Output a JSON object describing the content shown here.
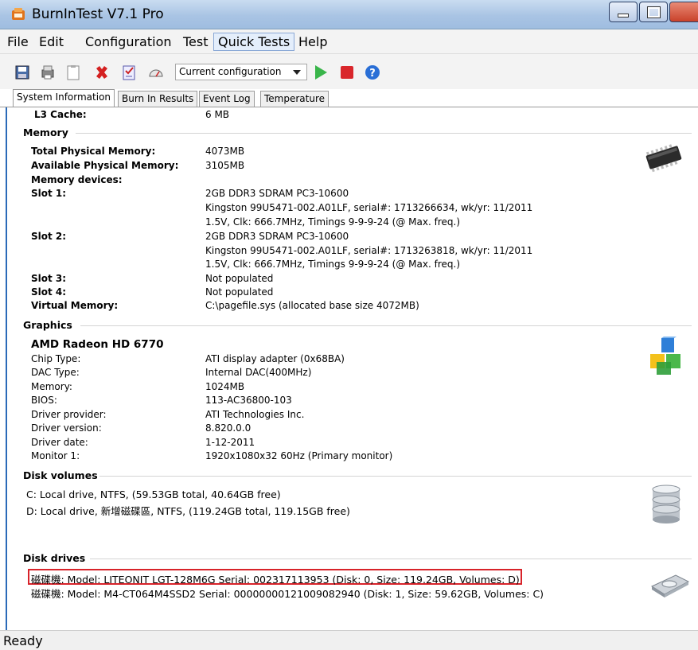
{
  "window": {
    "title": "BurnInTest V7.1 Pro"
  },
  "menu": [
    "File",
    "Edit",
    "Configuration",
    "Test",
    "Quick Tests",
    "Help"
  ],
  "toolbar": {
    "config_value": "Current configuration"
  },
  "tabs": [
    "System Information",
    "Burn In Results",
    "Event Log",
    "Temperature"
  ],
  "cpu_partial": {
    "label": "L3 Cache:",
    "value": "6 MB"
  },
  "memory": {
    "header": "Memory",
    "rows": [
      {
        "label": "Total Physical Memory:",
        "value": "4073MB"
      },
      {
        "label": "Available Physical Memory:",
        "value": "3105MB"
      },
      {
        "label": "Memory devices:",
        "value": ""
      },
      {
        "label": "Slot 1:",
        "value": "2GB DDR3 SDRAM PC3-10600"
      },
      {
        "label": "",
        "value": "Kingston 99U5471-002.A01LF, serial#: 1713266634, wk/yr: 11/2011"
      },
      {
        "label": "",
        "value": "1.5V, Clk: 666.7MHz, Timings 9-9-9-24 (@ Max. freq.)"
      },
      {
        "label": "Slot 2:",
        "value": "2GB DDR3 SDRAM PC3-10600"
      },
      {
        "label": "",
        "value": "Kingston 99U5471-002.A01LF, serial#: 1713263818, wk/yr: 11/2011"
      },
      {
        "label": "",
        "value": "1.5V, Clk: 666.7MHz, Timings 9-9-9-24 (@ Max. freq.)"
      },
      {
        "label": "Slot 3:",
        "value": "Not populated"
      },
      {
        "label": "Slot 4:",
        "value": "Not populated"
      },
      {
        "label": "Virtual Memory:",
        "value": "C:\\pagefile.sys (allocated base size 4072MB)"
      }
    ]
  },
  "graphics": {
    "header": "Graphics",
    "card_name": "AMD Radeon HD 6770",
    "rows": [
      {
        "label": "Chip Type:",
        "value": "ATI display adapter (0x68BA)"
      },
      {
        "label": "DAC Type:",
        "value": "Internal DAC(400MHz)"
      },
      {
        "label": "Memory:",
        "value": "1024MB"
      },
      {
        "label": "BIOS:",
        "value": "113-AC36800-103"
      },
      {
        "label": "Driver provider:",
        "value": "ATI Technologies Inc."
      },
      {
        "label": "Driver version:",
        "value": "8.820.0.0"
      },
      {
        "label": "Driver date:",
        "value": "1-12-2011"
      },
      {
        "label": "Monitor 1:",
        "value": "1920x1080x32 60Hz (Primary monitor)"
      }
    ]
  },
  "disk_volumes": {
    "header": "Disk volumes",
    "items": [
      "C: Local drive, NTFS, (59.53GB total, 40.64GB free)",
      "D: Local drive, 新增磁碟區, NTFS, (119.24GB total, 119.15GB free)"
    ]
  },
  "disk_drives": {
    "header": "Disk drives",
    "items": [
      "磁碟機: Model: LITEONIT LGT-128M6G Serial: 002317113953 (Disk: 0, Size: 119.24GB, Volumes: D)",
      "磁碟機: Model: M4-CT064M4SSD2 Serial: 00000000121009082940 (Disk: 1, Size: 59.62GB, Volumes: C)"
    ]
  },
  "status": {
    "text": "Ready"
  }
}
